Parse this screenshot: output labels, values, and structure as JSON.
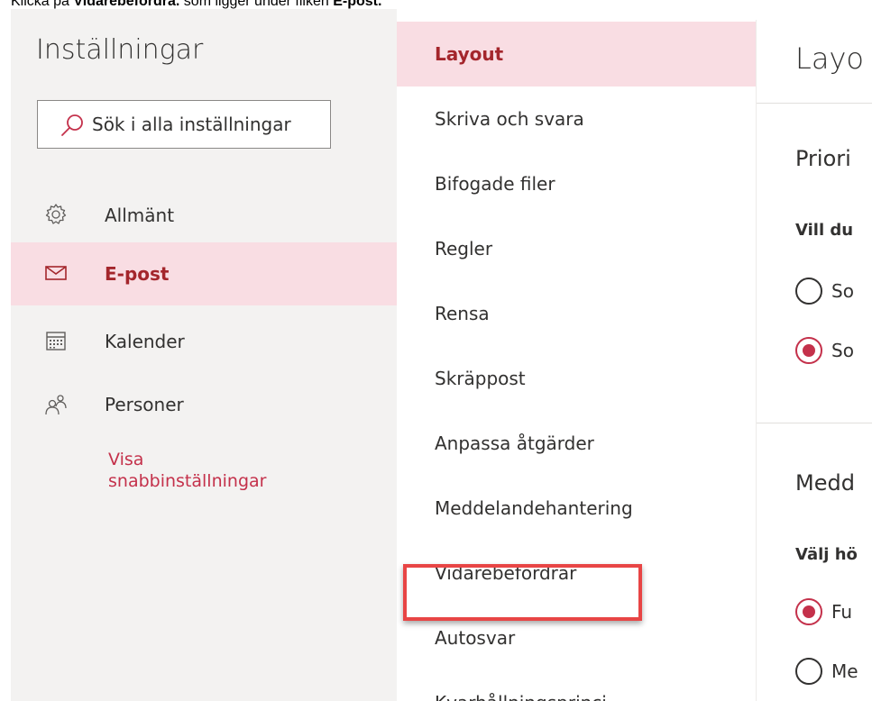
{
  "caption": {
    "prefix": "Klicka på ",
    "bold_target": "Vidarebefordra.",
    "middle": " som ligger under fliken ",
    "bold_tab": "E-post."
  },
  "left_pane": {
    "title": "Inställningar",
    "search_placeholder": "Sök i alla inställningar",
    "items": [
      {
        "label": "Allmänt",
        "icon": "gear-icon",
        "selected": false
      },
      {
        "label": "E-post",
        "icon": "mail-icon",
        "selected": true
      },
      {
        "label": "Kalender",
        "icon": "calendar-icon",
        "selected": false
      },
      {
        "label": "Personer",
        "icon": "people-icon",
        "selected": false
      }
    ],
    "quick_settings_link": "Visa\nsnabbinställningar"
  },
  "mid_pane": {
    "items": [
      {
        "label": "Layout",
        "selected": true
      },
      {
        "label": "Skriva och svara"
      },
      {
        "label": "Bifogade filer"
      },
      {
        "label": "Regler"
      },
      {
        "label": "Rensa"
      },
      {
        "label": "Skräppost"
      },
      {
        "label": "Anpassa åtgärder"
      },
      {
        "label": "Meddelandehantering"
      },
      {
        "label": "Vidarebefordrar",
        "highlighted": true
      },
      {
        "label": "Autosvar"
      },
      {
        "label": "Kvarhållningsprinci"
      }
    ]
  },
  "right_pane": {
    "title": "Layo",
    "section1": {
      "heading": "Priori",
      "question": "Vill du",
      "options": [
        {
          "text": "So",
          "checked": false
        },
        {
          "text": "So",
          "checked": true
        }
      ]
    },
    "section2": {
      "heading": "Medd",
      "question": "Välj hö",
      "options": [
        {
          "text": "Fu",
          "checked": true
        },
        {
          "text": "Me",
          "checked": false
        }
      ]
    }
  },
  "colors": {
    "accent": "#c4314b",
    "selected_bg": "#f9dde3",
    "pane_bg": "#f3f2f1",
    "highlight_box": "#e84545"
  }
}
